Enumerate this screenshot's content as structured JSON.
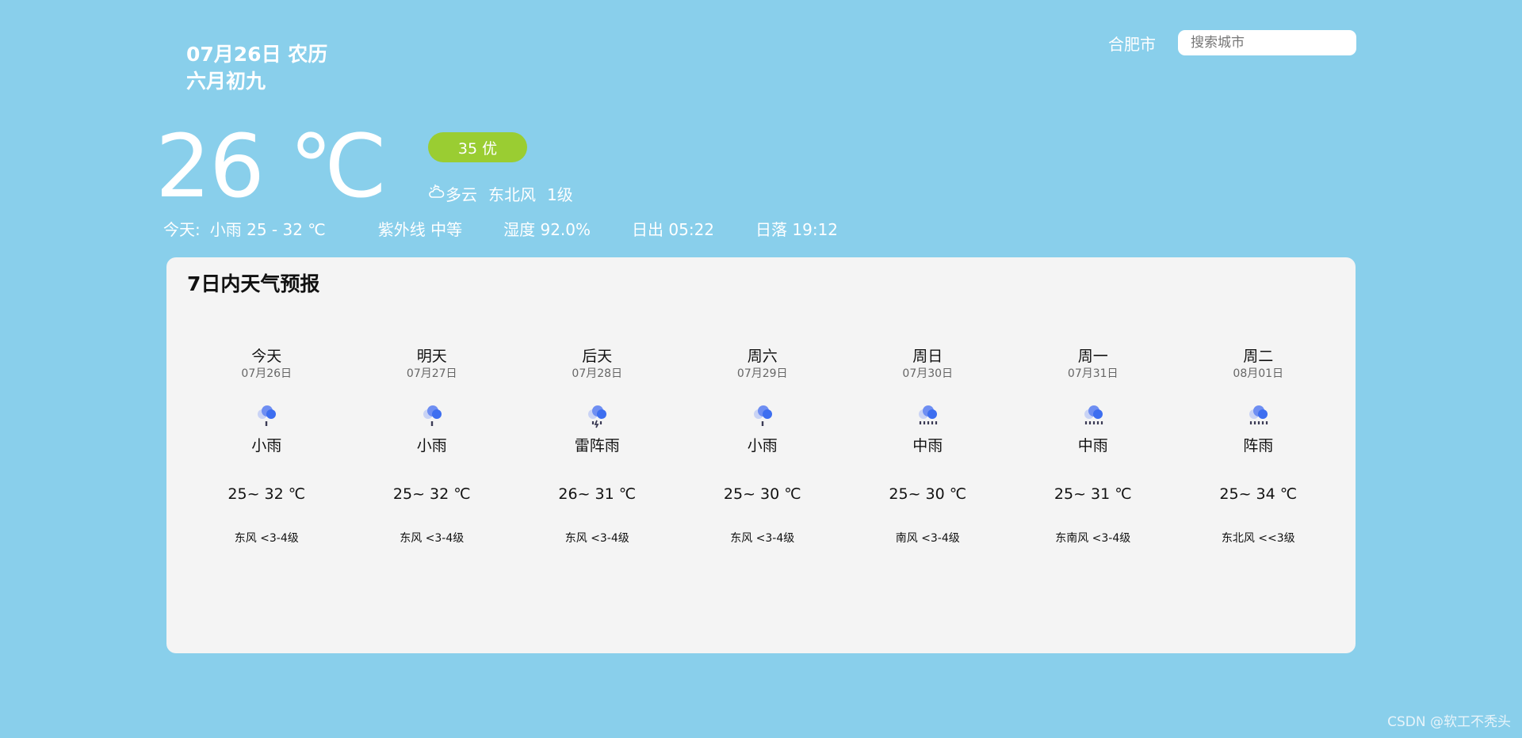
{
  "header": {
    "date_line1": "07月26日 农历",
    "date_line2": "六月初九",
    "city": "合肥市",
    "search_placeholder": "搜索城市"
  },
  "current": {
    "temperature": "26 ℃",
    "aqi": "35 优",
    "icon": "cloudy-icon",
    "condition": "多云",
    "wind_direction": "东北风",
    "wind_level": "1级"
  },
  "stats": {
    "today_label": "今天:",
    "today_value": "小雨 25 - 32 ℃",
    "uv": "紫外线 中等",
    "humidity": "湿度 92.0%",
    "sunrise": "日出 05:22",
    "sunset": "日落 19:12"
  },
  "forecast": {
    "title": "7日内天气预报",
    "days": [
      {
        "name": "今天",
        "date": "07月26日",
        "icon": "light-rain-icon",
        "cond": "小雨",
        "temp": "25~ 32 ℃",
        "wind": "东风 <3-4级"
      },
      {
        "name": "明天",
        "date": "07月27日",
        "icon": "light-rain-icon",
        "cond": "小雨",
        "temp": "25~ 32 ℃",
        "wind": "东风 <3-4级"
      },
      {
        "name": "后天",
        "date": "07月28日",
        "icon": "thunder-rain-icon",
        "cond": "雷阵雨",
        "temp": "26~ 31 ℃",
        "wind": "东风 <3-4级"
      },
      {
        "name": "周六",
        "date": "07月29日",
        "icon": "light-rain-icon",
        "cond": "小雨",
        "temp": "25~ 30 ℃",
        "wind": "东风 <3-4级"
      },
      {
        "name": "周日",
        "date": "07月30日",
        "icon": "moderate-rain-icon",
        "cond": "中雨",
        "temp": "25~ 30 ℃",
        "wind": "南风 <3-4级"
      },
      {
        "name": "周一",
        "date": "07月31日",
        "icon": "moderate-rain-icon",
        "cond": "中雨",
        "temp": "25~ 31 ℃",
        "wind": "东南风 <3-4级"
      },
      {
        "name": "周二",
        "date": "08月01日",
        "icon": "shower-rain-icon",
        "cond": "阵雨",
        "temp": "25~ 34 ℃",
        "wind": "东北风 <<3级"
      }
    ]
  },
  "watermark": "CSDN @软工不秃头",
  "colors": {
    "background": "#89CFEB",
    "card": "#F4F4F4",
    "aqi_good": "#9ACD32",
    "icon_blue": "#3D6EF0"
  }
}
